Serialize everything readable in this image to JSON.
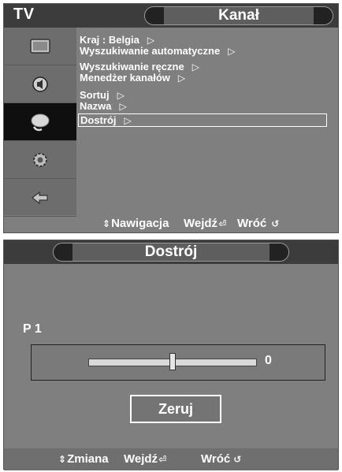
{
  "colors": {
    "panel_bg": "#7f7f7f",
    "header_bg": "#3c3c3c",
    "sidebar_bg": "#6d6d6d",
    "sidebar_active_bg": "#0f0f0f",
    "text": "#ffffff"
  },
  "menu_panel": {
    "tv_label": "TV",
    "title": "Kanał",
    "sidebar_icons": [
      "picture-icon",
      "sound-icon",
      "channel-icon",
      "setup-icon",
      "input-icon"
    ],
    "active_sidebar_index": 2,
    "items": [
      {
        "label": "Kraj  : Belgia",
        "arrow": "▷"
      },
      {
        "label": "Wyszukiwanie automatyczne",
        "arrow": "▷"
      },
      {
        "label": "Wyszukiwanie ręczne",
        "arrow": "▷"
      },
      {
        "label": "Menedżer kanałów",
        "arrow": "▷"
      },
      {
        "label": "Sortuj",
        "arrow": "▷"
      },
      {
        "label": "Nazwa",
        "arrow": "▷"
      },
      {
        "label": "Dostrój",
        "arrow": "▷"
      }
    ],
    "selected_index": 6,
    "footer": {
      "nav_label": "Nawigacja",
      "enter_label": "Wejdź",
      "back_label": "Wróć"
    }
  },
  "tune_panel": {
    "title": "Dostrój",
    "channel": "P 1",
    "slider_value": "0",
    "slider_fraction": 0.5,
    "reset_label": "Zeruj",
    "footer": {
      "change_label": "Zmiana",
      "enter_label": "Wejdź",
      "back_label": "Wróć"
    }
  }
}
